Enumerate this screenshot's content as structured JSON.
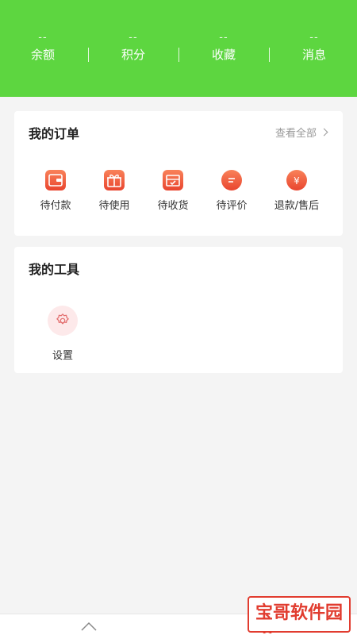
{
  "header": {
    "bg_color": "#5dd640",
    "stats": [
      {
        "value": "--",
        "label": "余额"
      },
      {
        "value": "--",
        "label": "积分"
      },
      {
        "value": "--",
        "label": "收藏"
      },
      {
        "value": "--",
        "label": "消息"
      }
    ]
  },
  "orders": {
    "title": "我的订单",
    "view_all": "查看全部",
    "items": [
      {
        "label": "待付款",
        "icon": "wallet-icon"
      },
      {
        "label": "待使用",
        "icon": "gift-icon"
      },
      {
        "label": "待收货",
        "icon": "package-icon"
      },
      {
        "label": "待评价",
        "icon": "comment-icon"
      },
      {
        "label": "退款/售后",
        "icon": "refund-icon"
      }
    ]
  },
  "tools": {
    "title": "我的工具",
    "items": [
      {
        "label": "设置",
        "icon": "gear-icon"
      }
    ]
  },
  "watermark": {
    "text": "宝哥软件园",
    "color": "#e13c2f"
  }
}
